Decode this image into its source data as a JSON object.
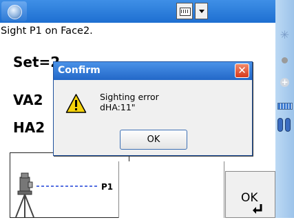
{
  "toolbar": {
    "start_icon": "windows-start-orb-icon",
    "keyboard_icon": "keyboard-icon",
    "keyboard_dropdown_icon": "chevron-down-icon"
  },
  "screen": {
    "instruction": "Sight P1 on Face2.",
    "set_label": "Set=2",
    "va2_label": "VA2",
    "ha2_label": "HA2",
    "diagram_point_label": "P1",
    "ok_button_label": "OK"
  },
  "dialog": {
    "title": "Confirm",
    "message_line1": "Sighting error",
    "message_line2": "dHA:11\"",
    "ok_label": "OK",
    "icon": "warning-icon"
  },
  "side_icons": [
    "star-icon",
    "dot-icon",
    "plus-icon",
    "battery-icon",
    "record-icon"
  ],
  "colors": {
    "taskbar_blue": "#2a7bdc",
    "dialog_title_blue": "#2f78d6",
    "close_red": "#e04a2b",
    "warning_yellow": "#f5d20b"
  }
}
